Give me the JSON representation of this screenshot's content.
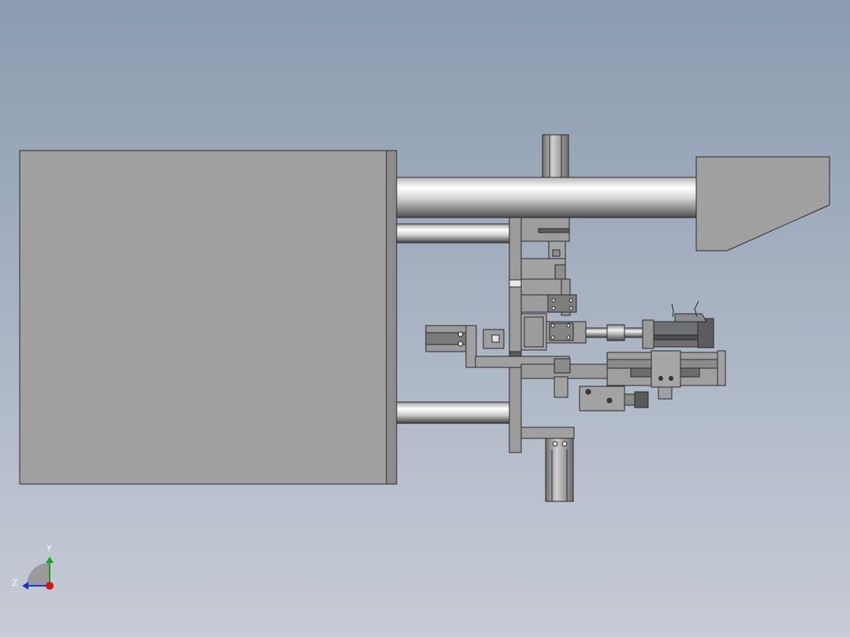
{
  "viewport": {
    "background_top": "#8b9bb0",
    "background_bottom": "#c7ccd6",
    "part_fill": "#a0a0a0",
    "part_dark": "#7c7c7c",
    "part_edge": "#2a2a2a",
    "motor_fill": "#6e7073",
    "motor_dark": "#4c4e52"
  },
  "triad": {
    "y_label": "Y",
    "z_label": "Z",
    "y_color": "#21a121",
    "z_color": "#2233cc",
    "x_color": "#d01818",
    "base_color": "#9a9a9a"
  }
}
